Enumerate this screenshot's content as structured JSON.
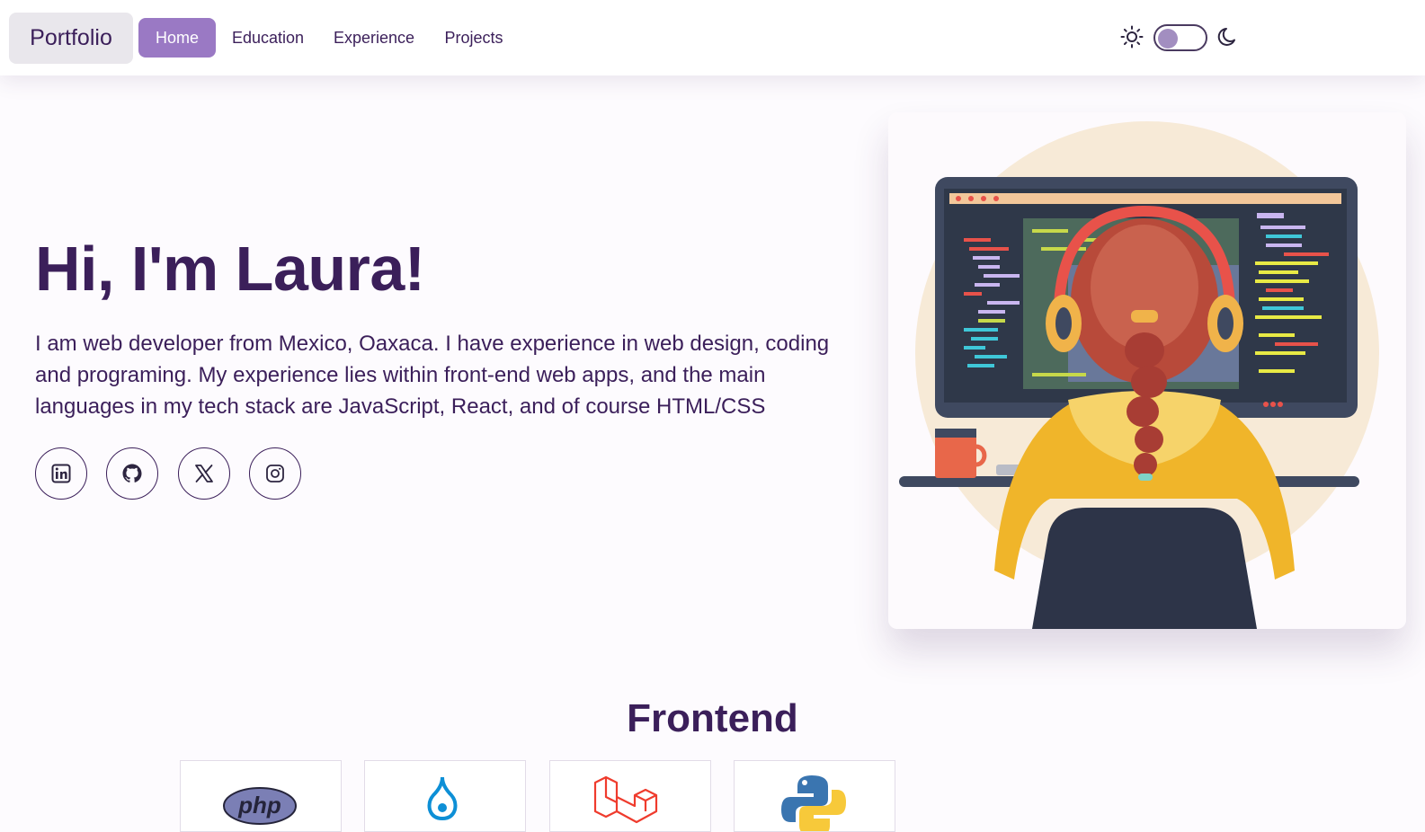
{
  "navbar": {
    "brand": "Portfolio",
    "links": [
      {
        "label": "Home",
        "active": true
      },
      {
        "label": "Education",
        "active": false
      },
      {
        "label": "Experience",
        "active": false
      },
      {
        "label": "Projects",
        "active": false
      }
    ],
    "theme_toggle": {
      "light_icon": "sun-icon",
      "dark_icon": "moon-icon",
      "dark_mode": false
    }
  },
  "hero": {
    "title": "Hi, I'm Laura!",
    "description": "I am web developer from Mexico, Oaxaca. I have experience in web design, coding and programing. My experience lies within front-end web apps, and the main languages in my tech stack are JavaScript, React, and of course HTML/CSS",
    "socials": [
      {
        "icon": "linkedin-icon"
      },
      {
        "icon": "github-icon"
      },
      {
        "icon": "x-icon"
      },
      {
        "icon": "instagram-icon"
      }
    ],
    "illustration": "developer-at-computer-illustration"
  },
  "frontend": {
    "title": "Frontend",
    "technologies": [
      {
        "icon": "php-icon",
        "logo_text": "php"
      },
      {
        "icon": "drupal-icon"
      },
      {
        "icon": "laravel-icon"
      },
      {
        "icon": "python-icon"
      }
    ]
  },
  "colors": {
    "primary_text": "#3b1f5a",
    "accent": "#9a79c4",
    "background": "#fdfbfe"
  }
}
